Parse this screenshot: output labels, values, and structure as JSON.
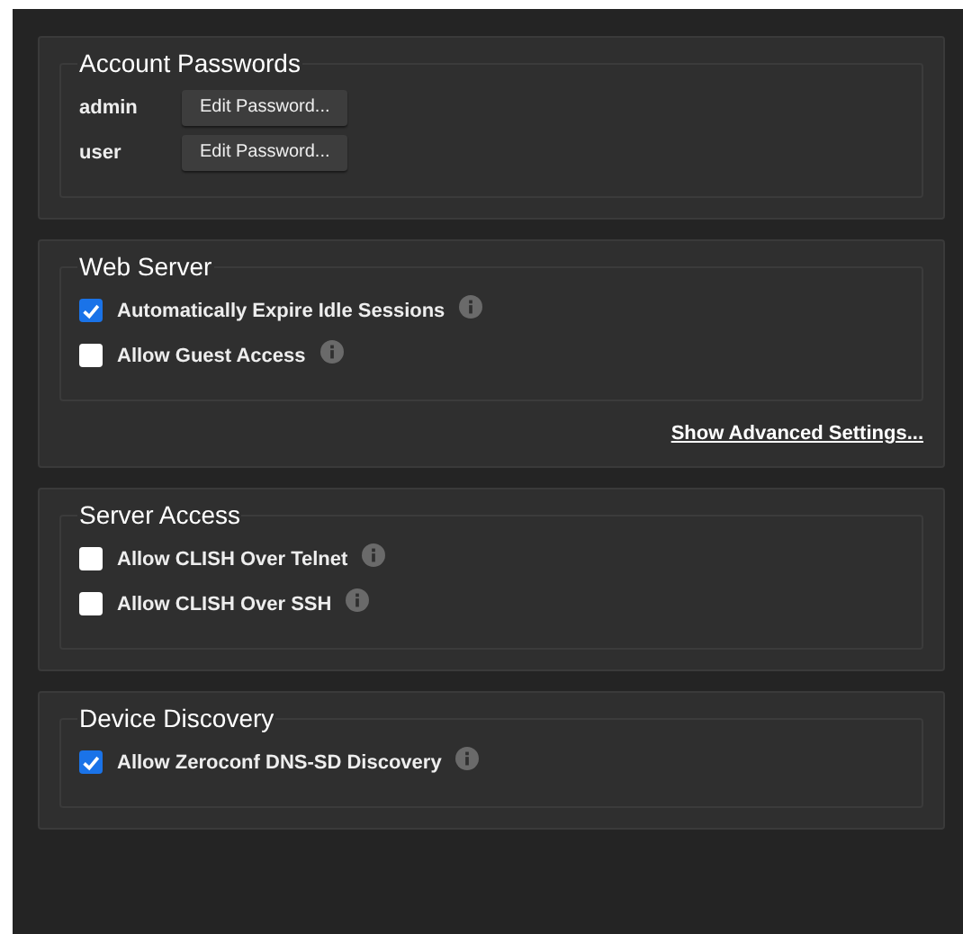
{
  "sections": [
    {
      "title": "Account Passwords",
      "kind": "accounts",
      "accounts": [
        {
          "name": "admin",
          "button": "Edit Password..."
        },
        {
          "name": "user",
          "button": "Edit Password..."
        }
      ]
    },
    {
      "title": "Web Server",
      "kind": "options",
      "options": [
        {
          "label": "Automatically Expire Idle Sessions",
          "checked": true,
          "info": true
        },
        {
          "label": "Allow Guest Access",
          "checked": false,
          "info": true
        }
      ],
      "link": "Show Advanced Settings..."
    },
    {
      "title": "Server Access",
      "kind": "options",
      "options": [
        {
          "label": "Allow CLISH Over Telnet",
          "checked": false,
          "info": true
        },
        {
          "label": "Allow CLISH Over SSH",
          "checked": false,
          "info": true
        }
      ]
    },
    {
      "title": "Device Discovery",
      "kind": "options",
      "options": [
        {
          "label": "Allow Zeroconf DNS-SD Discovery",
          "checked": true,
          "info": true
        }
      ]
    }
  ]
}
